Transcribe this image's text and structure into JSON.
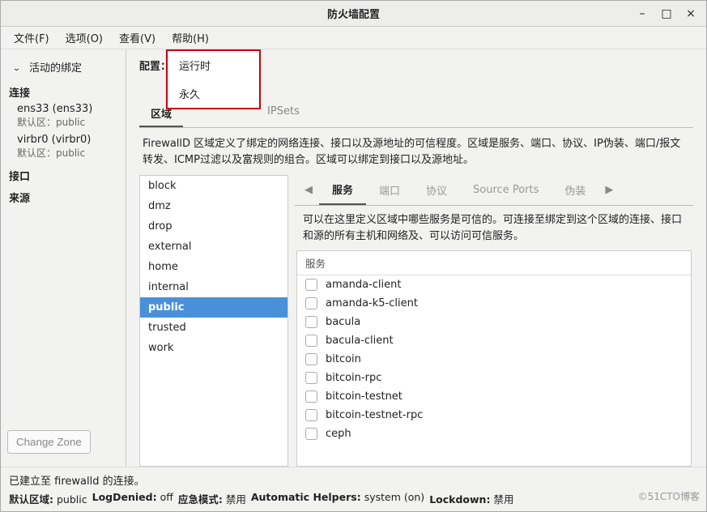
{
  "window": {
    "title": "防火墙配置"
  },
  "menubar": [
    "文件(F)",
    "选项(O)",
    "查看(V)",
    "帮助(H)"
  ],
  "sidebar": {
    "header": "活动的绑定",
    "sections": {
      "connections_label": "连接",
      "interfaces_label": "接口",
      "sources_label": "来源"
    },
    "connections": [
      {
        "name": "ens33 (ens33)",
        "zone": "默认区：public"
      },
      {
        "name": "virbr0 (virbr0)",
        "zone": "默认区：public"
      }
    ],
    "change_zone": "Change Zone"
  },
  "config": {
    "label": "配置：",
    "options": [
      "运行时",
      "永久"
    ]
  },
  "top_tabs": [
    "区域",
    "",
    "IPSets"
  ],
  "zone_desc": "FirewallD 区域定义了绑定的网络连接、接口以及源地址的可信程度。区域是服务、端口、协议、IP伪装、端口/报文转发、ICMP过滤以及富规则的组合。区域可以绑定到接口以及源地址。",
  "zones": [
    "block",
    "dmz",
    "drop",
    "external",
    "home",
    "internal",
    "public",
    "trusted",
    "work"
  ],
  "zone_selected": "public",
  "svc_tabs": [
    "服务",
    "端口",
    "协议",
    "Source Ports",
    "伪装"
  ],
  "svc_desc": "可以在这里定义区域中哪些服务是可信的。可连接至绑定到这个区域的连接、接口和源的所有主机和网络及、可以访问可信服务。",
  "svc_header": "服务",
  "services": [
    "amanda-client",
    "amanda-k5-client",
    "bacula",
    "bacula-client",
    "bitcoin",
    "bitcoin-rpc",
    "bitcoin-testnet",
    "bitcoin-testnet-rpc",
    "ceph"
  ],
  "footer": {
    "connected": "已建立至 firewalld 的连接。",
    "default_zone_label": "默认区域:",
    "default_zone_value": "public",
    "log_denied_label": "LogDenied:",
    "log_denied_value": "off",
    "panic_label": "应急模式:",
    "panic_value": "禁用",
    "auto_helpers_label": "Automatic Helpers:",
    "auto_helpers_value": "system (on)",
    "lockdown_label": "Lockdown:",
    "lockdown_value": "禁用"
  },
  "watermark": "©51CTO博客"
}
